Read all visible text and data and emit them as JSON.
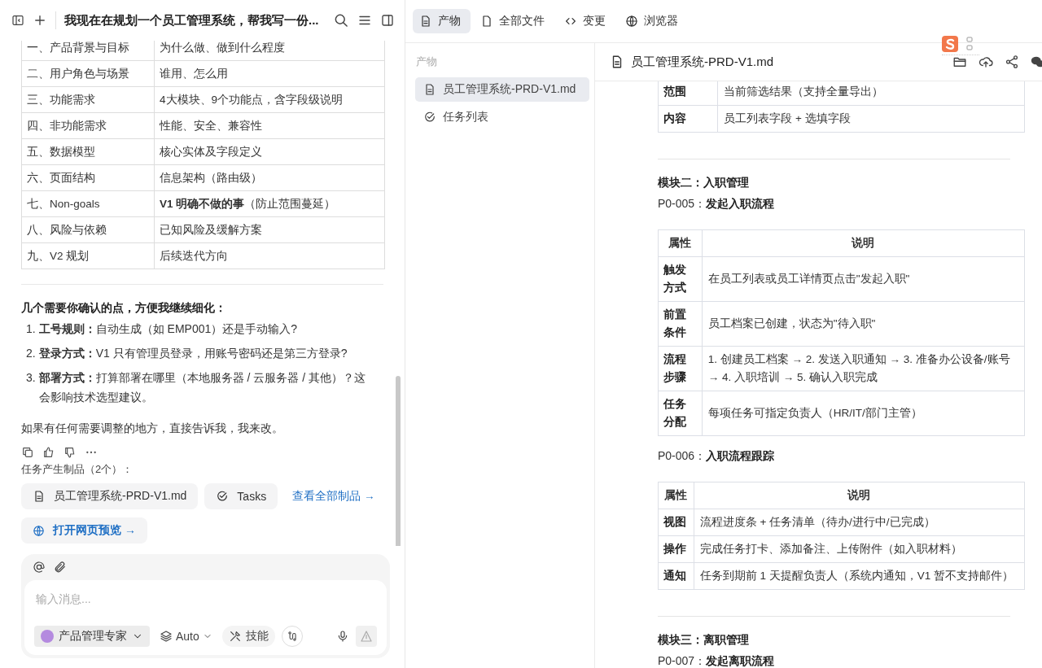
{
  "chat": {
    "title": "我现在在规划一个员工管理系统，帮我写一份...",
    "outline": [
      {
        "section": "一、产品背景与目标",
        "desc": "为什么做、做到什么程度"
      },
      {
        "section": "二、用户角色与场景",
        "desc": "谁用、怎么用"
      },
      {
        "section": "三、功能需求",
        "desc": "4大模块、9个功能点，含字段级说明"
      },
      {
        "section": "四、非功能需求",
        "desc": "性能、安全、兼容性"
      },
      {
        "section": "五、数据模型",
        "desc": "核心实体及字段定义"
      },
      {
        "section": "六、页面结构",
        "desc": "信息架构（路由级）"
      },
      {
        "section": "七、Non-goals",
        "desc": "**V1 明确不做的事**（防止范围蔓延）"
      },
      {
        "section": "八、风险与依赖",
        "desc": "已知风险及缓解方案"
      },
      {
        "section": "九、V2 规划",
        "desc": "后续迭代方向"
      }
    ],
    "questions_heading": "几个需要你确认的点，方便我继续细化：",
    "questions": [
      {
        "number": "1.",
        "text": "**工号规则：**自动生成（如 EMP001）还是手动输入?"
      },
      {
        "number": "2.",
        "text": "**登录方式：**V1 只有管理员登录，用账号密码还是第三方登录?"
      },
      {
        "number": "3.",
        "text": "**部署方式：**打算部署在哪里（本地服务器 / 云服务器 / 其他）？这会影响技术选型建议。"
      }
    ],
    "closing": "如果有任何需要调整的地方，直接告诉我，我来改。",
    "artifacts_label": "任务产生制品（2个）：",
    "artifacts": [
      {
        "kind": "doc",
        "label": "员工管理系统-PRD-V1.md"
      },
      {
        "kind": "tasks",
        "label": "Tasks"
      }
    ],
    "view_all": "查看全部制品 →",
    "preview": "打开网页预览 →",
    "composer": {
      "placeholder": "输入消息...",
      "agent": "产品管理专家",
      "model": "Auto",
      "skills": "技能",
      "send_disabled": true
    }
  },
  "tabs": [
    {
      "kind": "doc",
      "label": "产物",
      "selected": true
    },
    {
      "kind": "file",
      "label": "全部文件",
      "selected": false
    },
    {
      "kind": "code",
      "label": "变更",
      "selected": false
    },
    {
      "kind": "globe",
      "label": "浏览器",
      "selected": false
    }
  ],
  "sidebar": {
    "heading": "产物",
    "items": [
      {
        "kind": "doc",
        "label": "员工管理系统-PRD-V1.md",
        "selected": true
      },
      {
        "kind": "tasks",
        "label": "任务列表",
        "selected": false
      }
    ]
  },
  "document": {
    "title": "员工管理系统-PRD-V1.md",
    "blocks": [
      {
        "kind": "table",
        "rows": [
          [
            "范围",
            "当前筛选结果（支持全量导出）"
          ],
          [
            "内容",
            "员工列表字段 + 选填字段"
          ]
        ]
      },
      {
        "kind": "divider"
      },
      {
        "kind": "heading",
        "text": "模块二：入职管理"
      },
      {
        "kind": "subheading",
        "text": "P0-005：**发起入职流程**"
      },
      {
        "kind": "table",
        "header": [
          "属性",
          "说明"
        ],
        "rows": [
          [
            "触发方式",
            "在员工列表或员工详情页点击\"发起入职\""
          ],
          [
            "前置条件",
            "员工档案已创建，状态为\"待入职\""
          ],
          [
            "流程步骤",
            "1. 创建员工档案 → 2. 发送入职通知 → 3. 准备办公设备/账号 → 4. 入职培训 → 5. 确认入职完成"
          ],
          [
            "任务分配",
            "每项任务可指定负责人（HR/IT/部门主管）"
          ]
        ]
      },
      {
        "kind": "subheading",
        "text": "P0-006：**入职流程跟踪**"
      },
      {
        "kind": "table",
        "header": [
          "属性",
          "说明"
        ],
        "rows": [
          [
            "视图",
            "流程进度条 + 任务清单（待办/进行中/已完成）"
          ],
          [
            "操作",
            "完成任务打卡、添加备注、上传附件（如入职材料）"
          ],
          [
            "通知",
            "任务到期前 1 天提醒负责人（系统内通知，V1 暂不支持邮件）"
          ]
        ]
      },
      {
        "kind": "divider"
      },
      {
        "kind": "heading",
        "text": "模块三：离职管理"
      },
      {
        "kind": "subheading",
        "text": "P0-007：**发起离职流程**"
      }
    ]
  }
}
